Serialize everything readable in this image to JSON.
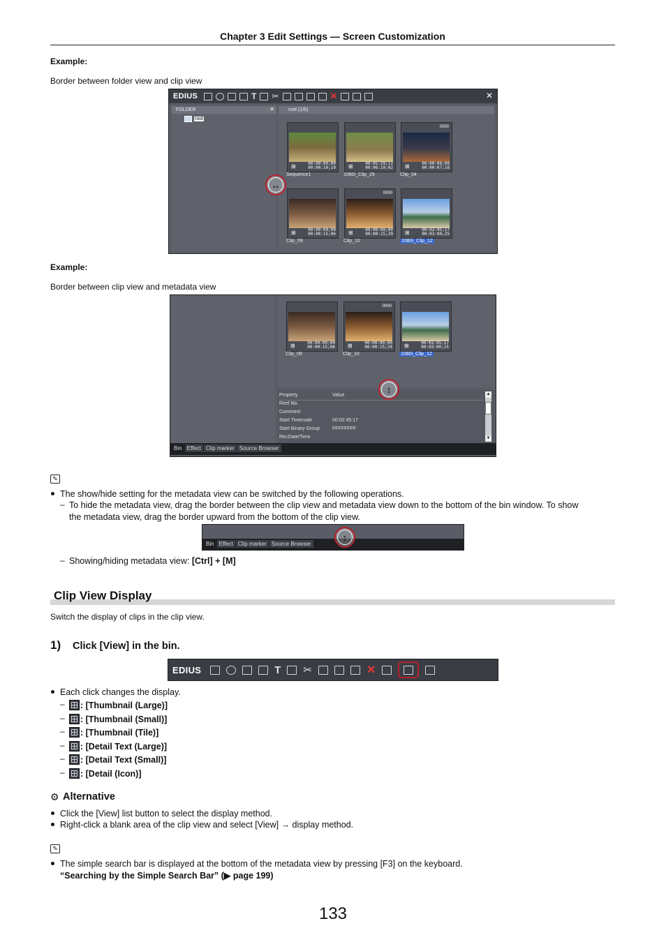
{
  "header": {
    "title": "Chapter 3   Edit Settings — Screen Customization"
  },
  "example1": {
    "label": "Example:",
    "text": "Border between folder view and clip view",
    "screenshot": {
      "app_name": "EDIUS",
      "folder_title": "FOLDER",
      "folder_root": "root",
      "clip_view_title": "root (1/6)",
      "clips": [
        {
          "name": "Sequence1",
          "tc1": "00:00:00;00",
          "tc2": "00:00:10;19",
          "badge": ""
        },
        {
          "name": "1080i_Clip_29",
          "tc1": "00:05:59;11",
          "tc2": "00:06:10;02",
          "badge": ""
        },
        {
          "name": "Clip_04",
          "tc1": "00:00:00;00",
          "tc2": "00:00:07;18",
          "badge": "0000"
        },
        {
          "name": "Clip_09",
          "tc1": "00:00:00;00",
          "tc2": "00:00:15;06",
          "badge": ""
        },
        {
          "name": "Clip_10",
          "tc1": "00:00:00;00",
          "tc2": "00:00:15;29",
          "badge": "0000"
        },
        {
          "name": "1080i_Clip_12",
          "tc1": "00:02:45;17",
          "tc2": "00:03:00;25",
          "badge": ""
        }
      ]
    }
  },
  "example2": {
    "label": "Example:",
    "text": "Border between clip view and metadata view",
    "screenshot": {
      "clips": [
        {
          "name": "Clip_09",
          "tc1": "00:00:00;00",
          "tc2": "00:00:15;06",
          "badge": ""
        },
        {
          "name": "Clip_10",
          "tc1": "00:00:00;00",
          "tc2": "00:00:15;29",
          "badge": "0000"
        },
        {
          "name": "1080i_Clip_12",
          "tc1": "00:02:45;17",
          "tc2": "00:03:00;25",
          "badge": ""
        }
      ],
      "meta_headers": {
        "property": "Property",
        "value": "Value"
      },
      "meta_rows": [
        {
          "property": "Reel No.",
          "value": ""
        },
        {
          "property": "Comment",
          "value": ""
        },
        {
          "property": "Start Timecode",
          "value": "00:02:45:17"
        },
        {
          "property": "Start Binary Group",
          "value": "FFFFFFFF"
        },
        {
          "property": "RecDate/Time",
          "value": ""
        }
      ],
      "tabs": [
        "Bin",
        "Effect",
        "Clip marker",
        "Source Browser"
      ]
    }
  },
  "note1": {
    "bullet": "The show/hide setting for the metadata view can be switched by the following operations.",
    "sub1": "To hide the metadata view, drag the border between the clip view and metadata view down to the bottom of the bin window. To show",
    "sub1b": "the metadata view, drag the border upward from the bottom of the clip view.",
    "mini_tabs": [
      "Bin",
      "Effect",
      "Clip marker",
      "Source Browser"
    ],
    "sub2_prefix": "Showing/hiding metadata view: ",
    "sub2_keys": "[Ctrl] + [M]"
  },
  "section": {
    "title": "Clip View Display",
    "intro": "Switch the display of clips in the clip view.",
    "step_num": "1)",
    "step_text": "Click [View] in the bin.",
    "toolbar_app": "EDIUS",
    "bullet": "Each click changes the display.",
    "modes": [
      ": [Thumbnail (Large)]",
      ": [Thumbnail (Small)]",
      ": [Thumbnail (Tile)]",
      ": [Detail Text (Large)]",
      ": [Detail Text (Small)]",
      ": [Detail (Icon)]"
    ]
  },
  "alternative": {
    "title": "Alternative",
    "items": [
      "Click the [View] list button to select the display method.",
      "Right-click a blank area of the clip view and select [View] → display method."
    ]
  },
  "note2": {
    "bullet": "The simple search bar is displayed at the bottom of the metadata view by pressing [F3] on the keyboard.",
    "link": "“Searching by the Simple Search Bar” (▶ page 199)"
  },
  "page_number": "133",
  "colors": {
    "accent_red": "#b8202c",
    "panel_bg": "#5a5d66",
    "toolbar_bg": "#3a3d44",
    "selection": "#3a67c8"
  }
}
